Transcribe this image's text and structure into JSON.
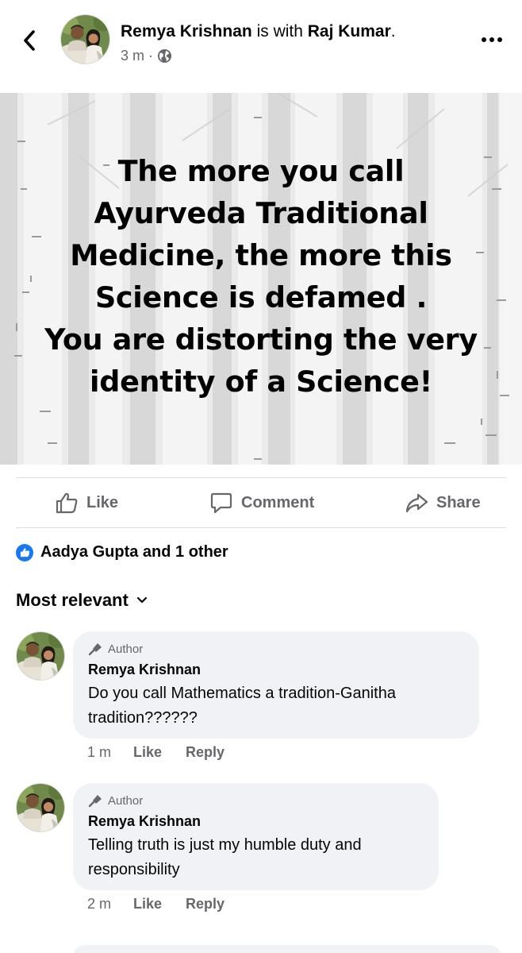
{
  "header": {
    "author": "Remya Krishnan",
    "with_text": " is with ",
    "tagged": "Raj Kumar",
    "tail": ".",
    "time": "3 m ·",
    "privacy_icon": "globe-icon",
    "back_icon": "chevron-left-icon",
    "more_icon": "more-horizontal-icon"
  },
  "post": {
    "lines": [
      "The more you call",
      "Ayurveda Traditional",
      "Medicine, the more this",
      "Science is defamed .",
      "You are distorting the very",
      "identity of a Science!"
    ]
  },
  "actions": {
    "like": "Like",
    "comment": "Comment",
    "share": "Share"
  },
  "reactions": {
    "text": "Aadya Gupta and 1 other",
    "icon": "like-badge-icon"
  },
  "sort": {
    "label": "Most relevant",
    "icon": "chevron-down-icon"
  },
  "comments": [
    {
      "badge": "Author",
      "name": "Remya Krishnan",
      "text_lines": [
        "Do you call Mathematics a tradition-Ganitha",
        "tradition??????"
      ],
      "time": "1 m",
      "like": "Like",
      "reply": "Reply"
    },
    {
      "badge": "Author",
      "name": "Remya Krishnan",
      "text_lines": [
        "Telling truth is just my humble duty and",
        "responsibility"
      ],
      "time": "2 m",
      "like": "Like",
      "reply": "Reply"
    }
  ],
  "colors": {
    "brand_blue": "#1877f2",
    "secondary_text": "#65676b",
    "bubble_bg": "#f0f2f5"
  }
}
